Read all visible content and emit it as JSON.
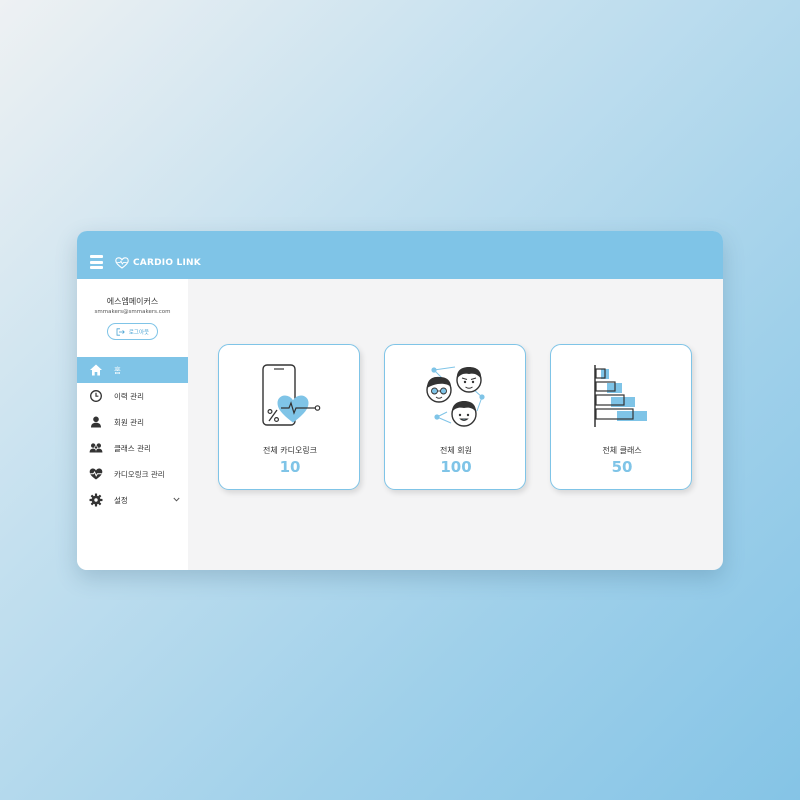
{
  "brand": {
    "name": "CARDIO LINK",
    "color": "#7fc4e7"
  },
  "user": {
    "name": "에스엠메이커스",
    "email": "smmakers@smmakers.com",
    "logout_label": "로그아웃"
  },
  "nav": {
    "items": [
      {
        "label": "홈",
        "icon": "home-icon",
        "active": true
      },
      {
        "label": "이력 관리",
        "icon": "clock-icon",
        "active": false
      },
      {
        "label": "회원 관리",
        "icon": "person-icon",
        "active": false
      },
      {
        "label": "클래스 관리",
        "icon": "group-icon",
        "active": false
      },
      {
        "label": "카디오링크 관리",
        "icon": "heart-pulse-icon",
        "active": false
      },
      {
        "label": "설정",
        "icon": "gear-icon",
        "active": false,
        "has_submenu": true
      }
    ]
  },
  "cards": [
    {
      "label": "전체 카디오링크",
      "value": "10",
      "icon": "phone-heart-icon"
    },
    {
      "label": "전체 회원",
      "value": "100",
      "icon": "members-faces-icon"
    },
    {
      "label": "전체 클래스",
      "value": "50",
      "icon": "bar-chart-icon"
    }
  ]
}
